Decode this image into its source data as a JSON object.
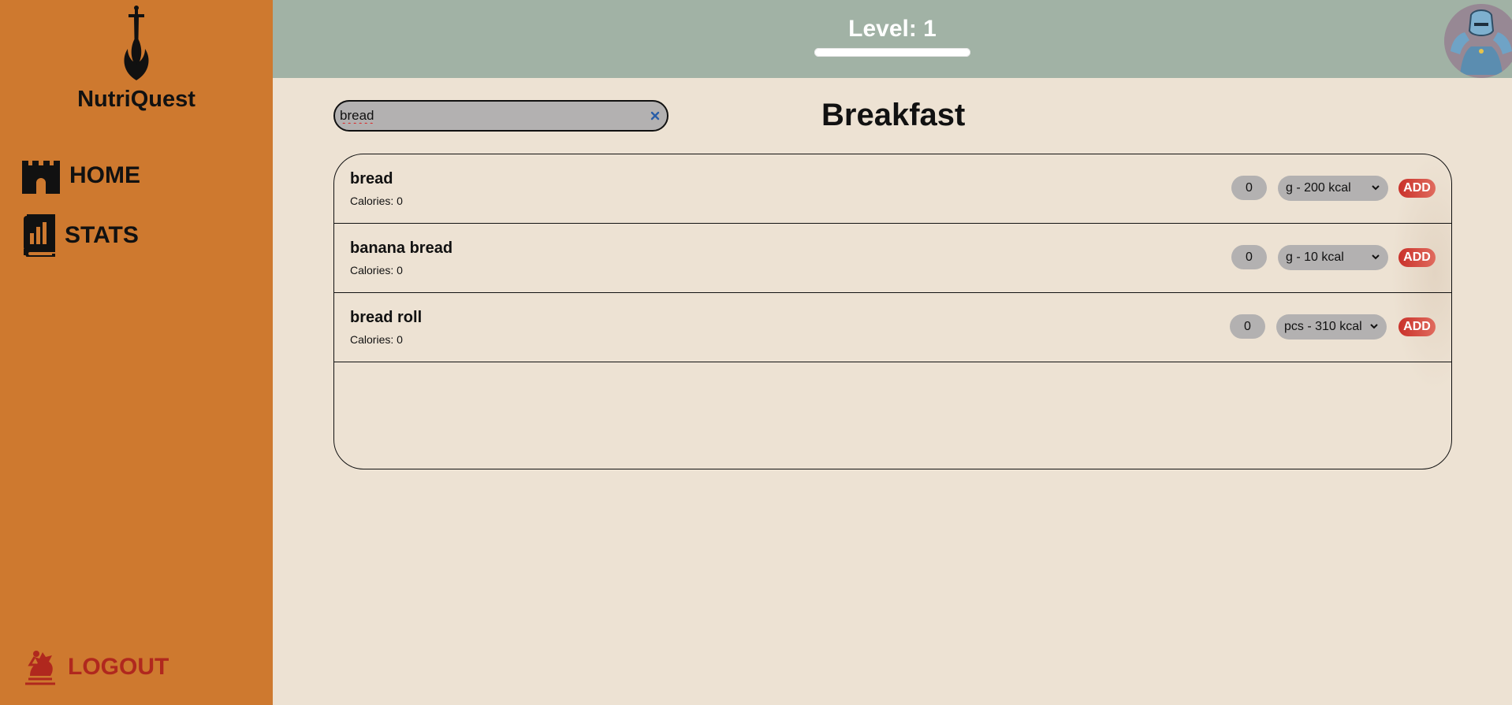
{
  "sidebar": {
    "app_name": "NutriQuest",
    "logo_icon": "sword-flame-logo",
    "nav": {
      "home": {
        "label": "HOME",
        "icon": "castle-icon"
      },
      "stats": {
        "label": "STATS",
        "icon": "stats-book-icon"
      },
      "logout": {
        "label": "LOGOUT",
        "icon": "knight-horse-icon",
        "color": "#B0281E"
      }
    },
    "background_color": "#CE792F"
  },
  "header": {
    "level_text": "Level: 1",
    "progress_fraction": 0,
    "avatar_icon": "knight-avatar",
    "background_color": "#A1B2A5"
  },
  "search": {
    "value": "bread",
    "clear_icon": "close-icon"
  },
  "meal": {
    "title": "Breakfast"
  },
  "foods": [
    {
      "name": "bread",
      "calories_text": "Calories: 0",
      "quantity": "0",
      "unit": "g - 200 kcal",
      "add_label": "ADD"
    },
    {
      "name": "banana bread",
      "calories_text": "Calories: 0",
      "quantity": "0",
      "unit": "g - 10 kcal",
      "add_label": "ADD"
    },
    {
      "name": "bread roll",
      "calories_text": "Calories: 0",
      "quantity": "0",
      "unit": "pcs - 310 kcal",
      "add_label": "ADD"
    }
  ],
  "colors": {
    "page_bg": "#EDE2D3",
    "accent_red": "#C9312A",
    "input_gray": "#B3B1B1"
  }
}
